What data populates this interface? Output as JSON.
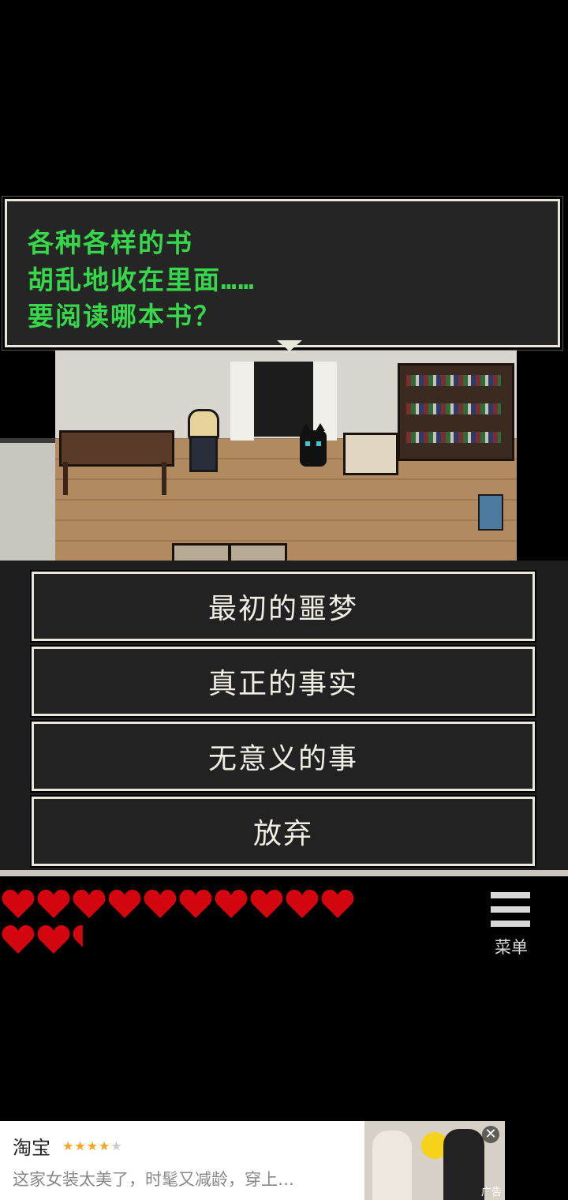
{
  "dialog": {
    "lines": [
      "各种各样的书",
      "胡乱地收在里面……",
      "要阅读哪本书？"
    ]
  },
  "choices": [
    {
      "label": "最初的噩梦"
    },
    {
      "label": "真正的事实"
    },
    {
      "label": "无意义的事"
    },
    {
      "label": "放弃"
    }
  ],
  "hud": {
    "health_full_hearts": 12,
    "health_partial_heart": 0.3,
    "heart_color": "#d3050f",
    "menu_label": "菜单"
  },
  "ad": {
    "title": "淘宝",
    "rating_stars": 4,
    "rating_max": 5,
    "description": "这家女装太美了，时髦又减龄，穿上…",
    "close_icon": "close-icon",
    "label": "广告"
  }
}
